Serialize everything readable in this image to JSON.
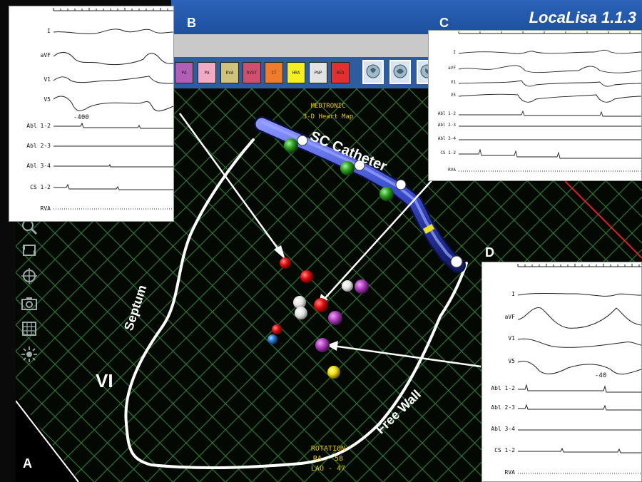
{
  "app": {
    "title": "LocaLisa 1.1.3"
  },
  "panels": {
    "a": "A",
    "b": "B",
    "c": "C",
    "d": "D"
  },
  "toolbar": {
    "buttons": [
      {
        "label": "PA",
        "color": "#b05fb4"
      },
      {
        "label": "PA",
        "color": "#f2a9c3"
      },
      {
        "label": "RVA",
        "color": "#cfc27a"
      },
      {
        "label": "RVOT",
        "color": "#d04f6e"
      },
      {
        "label": "CT",
        "color": "#ef7b2d"
      },
      {
        "label": "HRA",
        "color": "#f5ee22"
      },
      {
        "label": "PNP",
        "color": "#e2e2e2"
      },
      {
        "label": "RED",
        "color": "#e03030"
      }
    ],
    "view_icons": [
      "heart-view-1-icon",
      "heart-view-2-icon",
      "heart-view-3-icon"
    ]
  },
  "side_tools": [
    "zoom-icon",
    "rotate-icon",
    "crosshair-icon",
    "camera-icon",
    "grid-icon",
    "light-icon"
  ],
  "map": {
    "header_line1": "MEDTRONIC",
    "header_line2": "3-D Heart Map",
    "rotation_title": "ROTATION",
    "rotation_ra": "RA -  58",
    "rotation_lao": "LAO -  47",
    "catheter_label": "SC Catheter",
    "septum_label": "Septum",
    "free_wall_label": "Free Wall",
    "vi_label": "VI",
    "colors": {
      "grid": "#2e7d32",
      "catheter": "#3d4fcf",
      "outline": "#ffffff"
    }
  },
  "insets": {
    "b": {
      "leads": [
        "I",
        "aVF",
        "V1",
        "V5",
        "Abl 1-2",
        "Abl 2-3",
        "Abl 3-4",
        "CS 1-2",
        "RVA"
      ],
      "measure": "-400"
    },
    "c": {
      "leads": [
        "I",
        "aVF",
        "V1",
        "V5",
        "Abl 1-2",
        "Abl 2-3",
        "Abl 3-4",
        "CS 1-2",
        "RVA"
      ]
    },
    "d": {
      "leads": [
        "I",
        "aVF",
        "V1",
        "V5",
        "Abl 1-2",
        "Abl 2-3",
        "Abl 3-4",
        "CS 1-2",
        "RVA"
      ],
      "measure": "-40"
    }
  }
}
